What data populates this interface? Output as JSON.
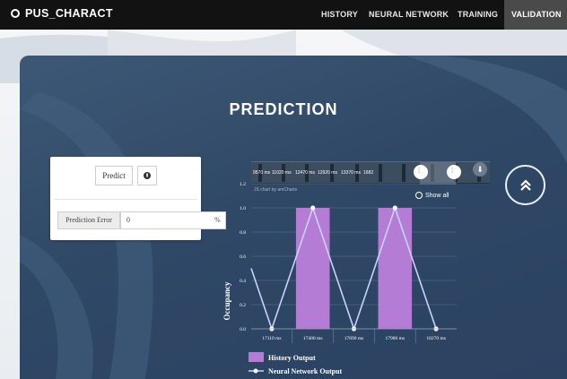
{
  "nav": {
    "brand": "PUS_CHARACT",
    "items": [
      {
        "label": "HISTORY",
        "active": false
      },
      {
        "label": "NEURAL NETWORK",
        "active": false
      },
      {
        "label": "TRAINING",
        "active": false
      },
      {
        "label": "VALIDATION",
        "active": true
      }
    ]
  },
  "page": {
    "title": "PREDICTION"
  },
  "form": {
    "predict_label": "Predict",
    "info_icon": "info-circle",
    "error_label": "Prediction Error",
    "error_value": "0",
    "unit": "%"
  },
  "scrollbar": {
    "labels": [
      "9570 ms",
      "11020 ms",
      "12470 ms",
      "12920 ms",
      "13370 ms",
      "1682"
    ],
    "left_handle_icon": "grip-icon",
    "right_handle_icon": "grip-icon",
    "download_icon": "download-icon"
  },
  "chart_credits": "JS chart by amCharts",
  "show_all": "Show all",
  "scroll_top_icon": "double-chevron-up-icon",
  "colors": {
    "nav_bg": "#121212",
    "panel_bg": "#2f4866",
    "bar_color": "#b57cd6",
    "line_color": "#c9d2ff"
  },
  "chart_data": {
    "type": "bar",
    "categories": [
      "17110 ms",
      "17400 ms",
      "17690 ms",
      "17980 ms",
      "18270 ms"
    ],
    "ylabel": "Occupancy",
    "ylim": [
      0,
      1.2
    ],
    "yticks": [
      "0.0",
      "0.2",
      "0.4",
      "0.6",
      "0.8",
      "1.0",
      "1.2"
    ],
    "series": [
      {
        "name": "History Output",
        "kind": "bar",
        "values": [
          0,
          1,
          0,
          1,
          0
        ]
      },
      {
        "name": "Neural Network Output",
        "kind": "line",
        "values": [
          0,
          1,
          0,
          1,
          0
        ]
      }
    ],
    "line_leading_value": 0.5,
    "legend_position": "bottom-left"
  }
}
